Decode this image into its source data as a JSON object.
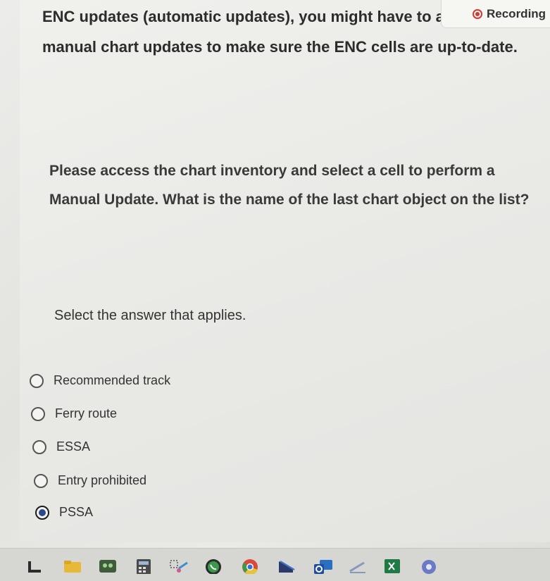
{
  "recording_badge": {
    "label": "Recording",
    "color": "#d0392f"
  },
  "intro_text": "ENC updates (automatic updates), you might have to additional manual chart updates to make sure the ENC cells are up-to-date.",
  "question": "Please access the chart inventory and select a cell to perform a Manual Update. What is the name of the last chart object on the list?",
  "instruction": "Select the answer that applies.",
  "options": [
    {
      "label": "Recommended track",
      "selected": false
    },
    {
      "label": "Ferry route",
      "selected": false
    },
    {
      "label": "ESSA",
      "selected": false
    },
    {
      "label": "Entry prohibited",
      "selected": false
    },
    {
      "label": "PSSA",
      "selected": true
    }
  ],
  "taskbar": {
    "icons": [
      "document-icon",
      "folder-icon",
      "photos-icon",
      "calculator-icon",
      "snipping-tool-icon",
      "whatsapp-icon",
      "chrome-icon",
      "pen-icon",
      "outlook-icon",
      "ruler-icon",
      "excel-icon",
      "settings-icon"
    ]
  }
}
